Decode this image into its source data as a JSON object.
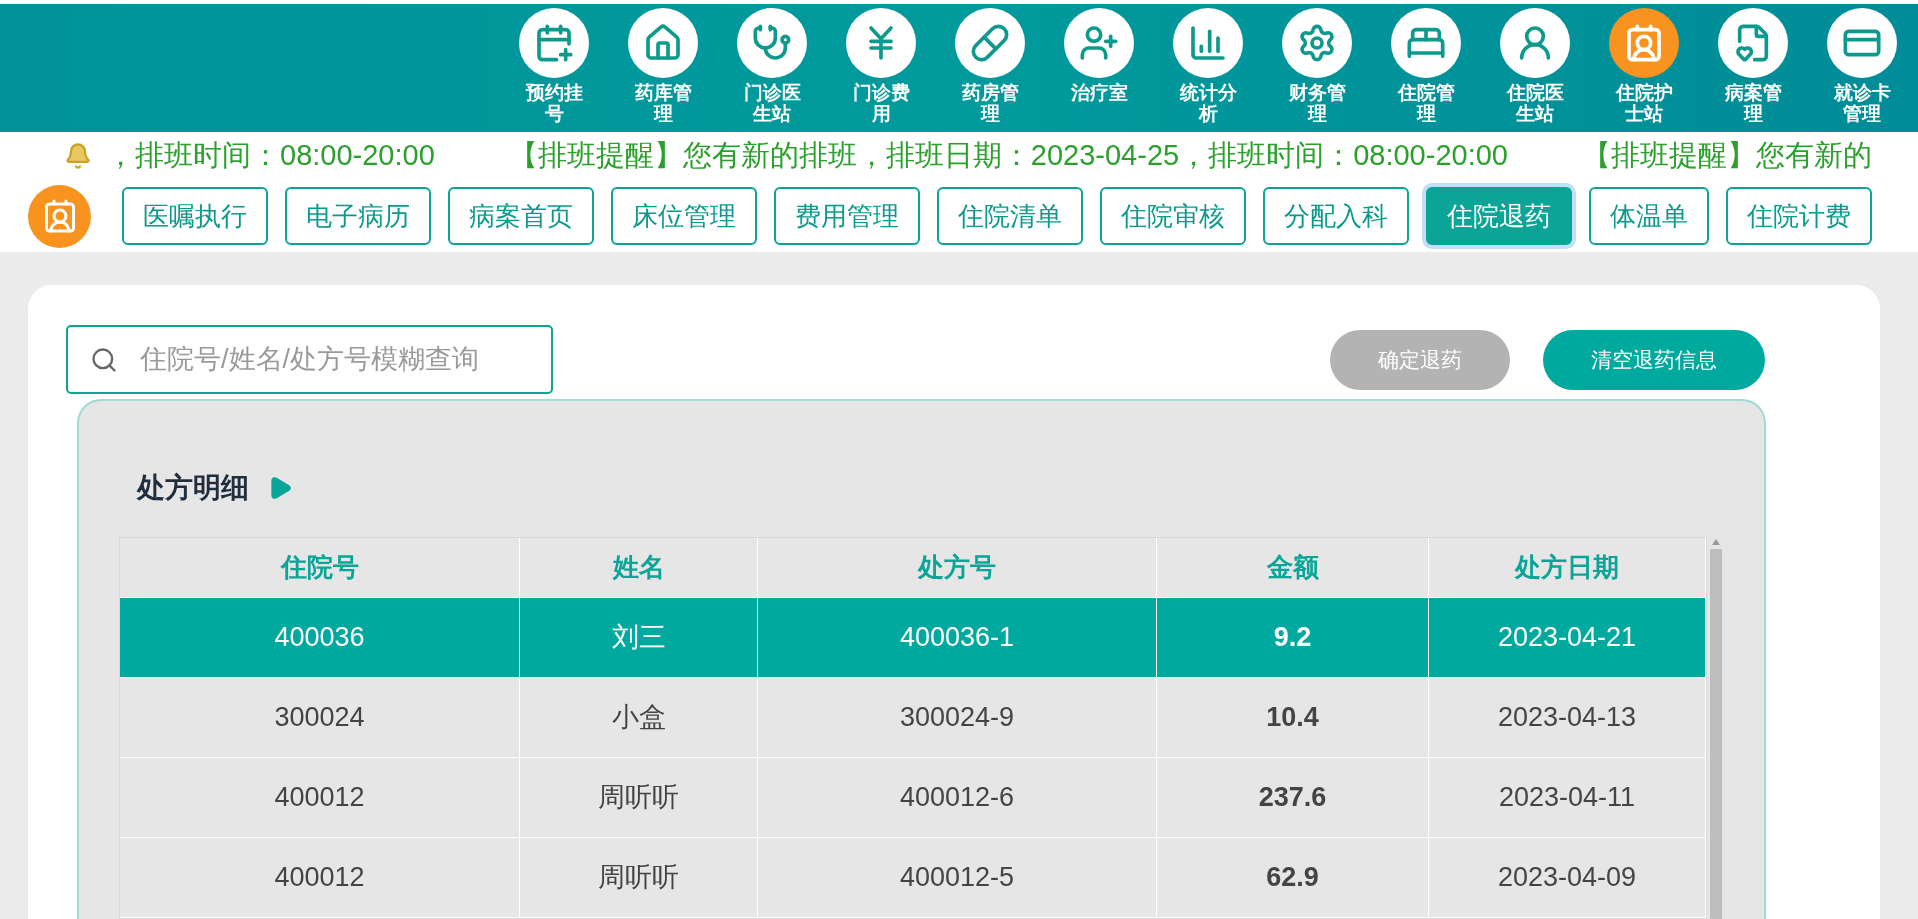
{
  "nav": [
    {
      "label": "预约挂号",
      "selected": false
    },
    {
      "label": "药库管理",
      "selected": false
    },
    {
      "label": "门诊医生站",
      "selected": false
    },
    {
      "label": "门诊费用",
      "selected": false
    },
    {
      "label": "药房管理",
      "selected": false
    },
    {
      "label": "治疗室",
      "selected": false
    },
    {
      "label": "统计分析",
      "selected": false
    },
    {
      "label": "财务管理",
      "selected": false
    },
    {
      "label": "住院管理",
      "selected": false
    },
    {
      "label": "住院医生站",
      "selected": false
    },
    {
      "label": "住院护士站",
      "selected": true
    },
    {
      "label": "病案管理",
      "selected": false
    },
    {
      "label": "就诊卡管理",
      "selected": false
    }
  ],
  "ticker": {
    "messages": [
      "，排班时间：08:00-20:00",
      "【排班提醒】您有新的排班，排班日期：2023-04-25，排班时间：08:00-20:00",
      "【排班提醒】您有新的"
    ]
  },
  "tabs": [
    {
      "label": "医嘱执行",
      "selected": false
    },
    {
      "label": "电子病历",
      "selected": false
    },
    {
      "label": "病案首页",
      "selected": false
    },
    {
      "label": "床位管理",
      "selected": false
    },
    {
      "label": "费用管理",
      "selected": false
    },
    {
      "label": "住院清单",
      "selected": false
    },
    {
      "label": "住院审核",
      "selected": false
    },
    {
      "label": "分配入科",
      "selected": false
    },
    {
      "label": "住院退药",
      "selected": true
    },
    {
      "label": "体温单",
      "selected": false
    },
    {
      "label": "住院计费",
      "selected": false
    }
  ],
  "search": {
    "placeholder": "住院号/姓名/处方号模糊查询"
  },
  "buttons": [
    {
      "label": "确定退药",
      "disabled": true
    },
    {
      "label": "清空退药信息",
      "disabled": false
    }
  ],
  "panel": {
    "title": "处方明细"
  },
  "table": {
    "columns": [
      "住院号",
      "姓名",
      "处方号",
      "金额",
      "处方日期"
    ],
    "rows": [
      {
        "cells": [
          "400036",
          "刘三",
          "400036-1",
          "9.2",
          "2023-04-21"
        ],
        "selected": true
      },
      {
        "cells": [
          "300024",
          "小盒",
          "300024-9",
          "10.4",
          "2023-04-13"
        ],
        "selected": false
      },
      {
        "cells": [
          "400012",
          "周听听",
          "400012-6",
          "237.6",
          "2023-04-11"
        ],
        "selected": false
      },
      {
        "cells": [
          "400012",
          "周听听",
          "400012-5",
          "62.9",
          "2023-04-09"
        ],
        "selected": false
      }
    ]
  }
}
